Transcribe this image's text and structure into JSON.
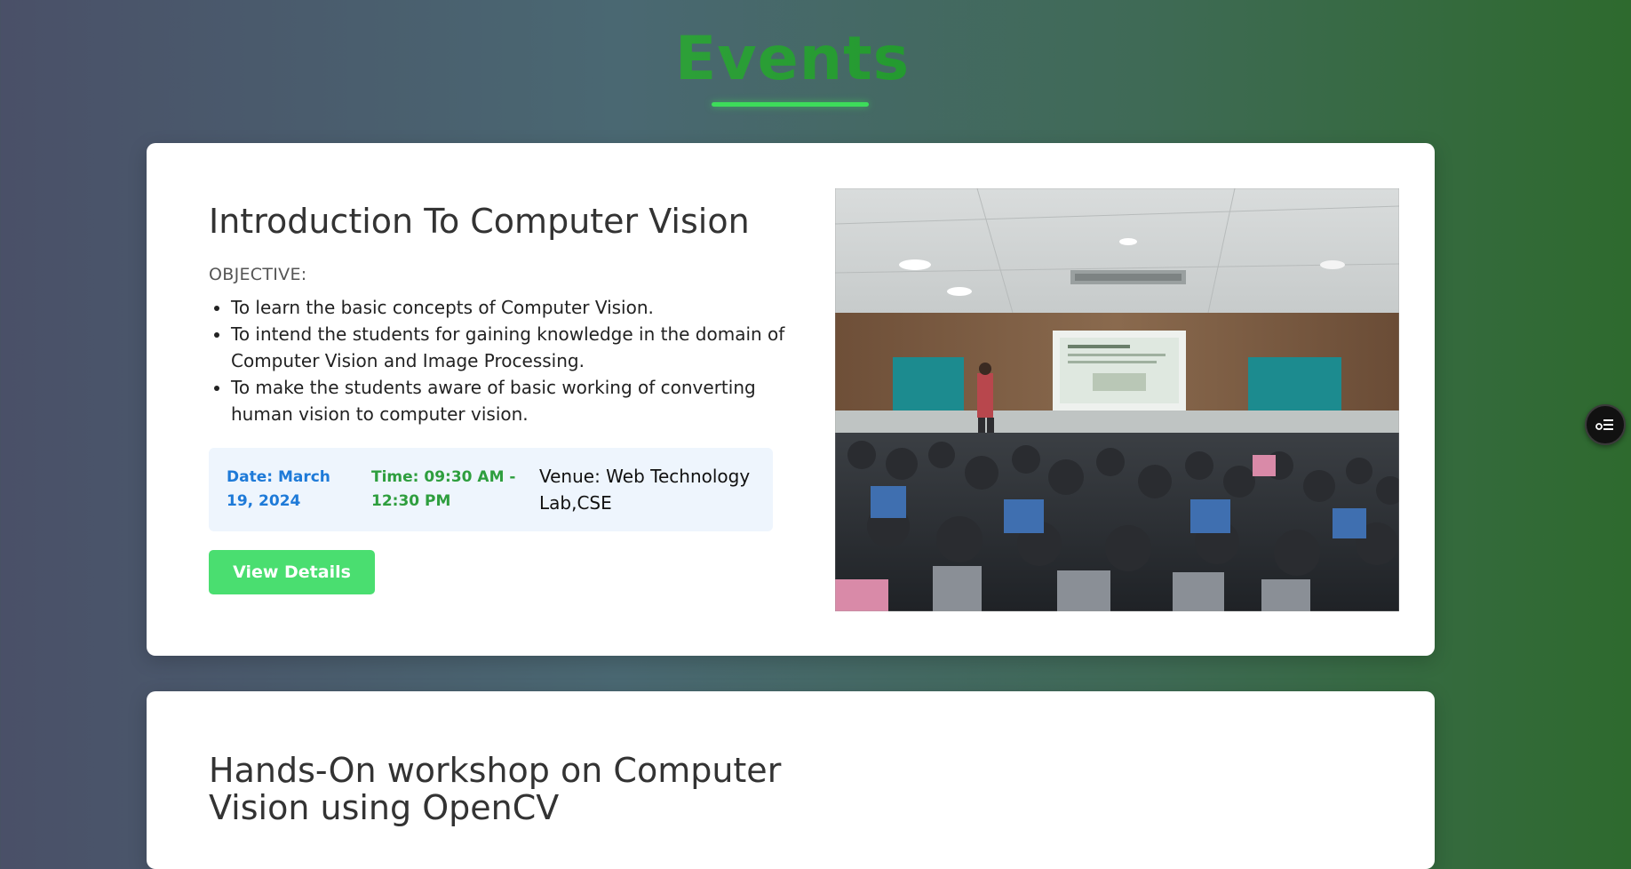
{
  "header": {
    "title": "Events"
  },
  "events": [
    {
      "title": "Introduction To Computer Vision",
      "objective_label": "OBJECTIVE:",
      "objectives": [
        "To learn the basic concepts of Computer Vision.",
        "To intend the students for gaining knowledge in the domain of Computer Vision and Image Processing.",
        "To make the students aware of basic working of converting human vision to computer vision."
      ],
      "date": "Date: March 19, 2024",
      "time": "Time: 09:30 AM - 12:30 PM",
      "venue": "Venue: Web Technology Lab,CSE",
      "button_label": "View Details"
    },
    {
      "title": "Hands-On workshop on Computer Vision using OpenCV"
    }
  ],
  "floating_button": {
    "icon": "menu-list-icon"
  },
  "colors": {
    "accent_green": "#4ade70",
    "date_blue": "#1e7ad8",
    "time_green": "#2e9e3e",
    "info_bg": "#eef5fd"
  }
}
